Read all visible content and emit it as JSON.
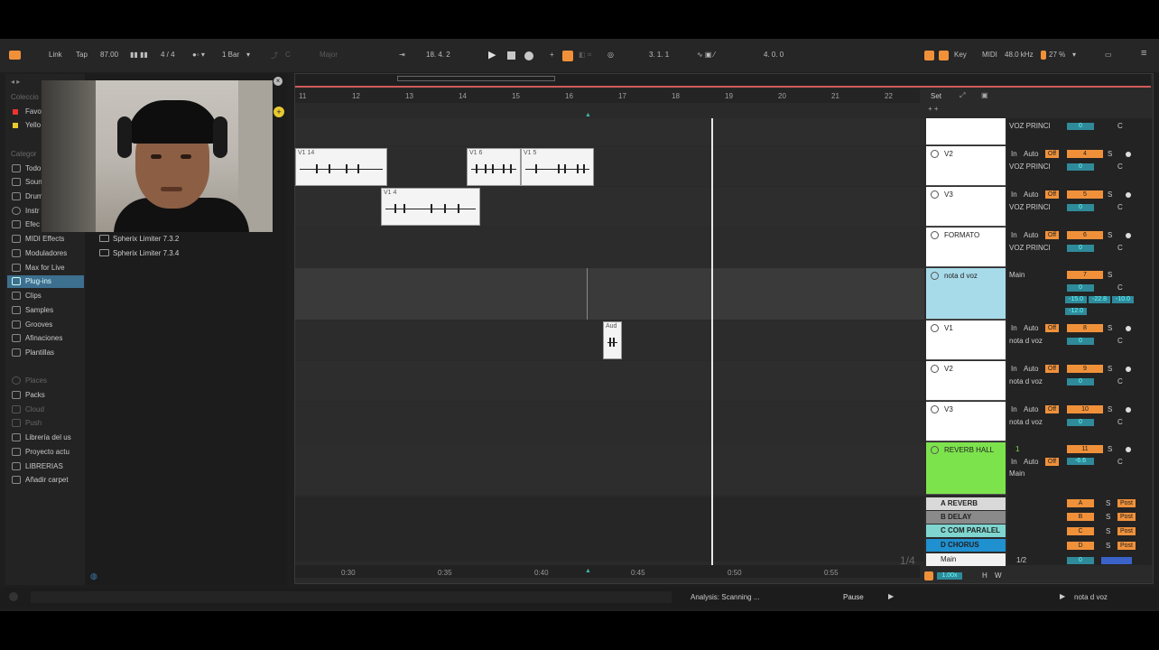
{
  "transport": {
    "link": "Link",
    "tap": "Tap",
    "tempo": "87.00",
    "signature": "4 / 4",
    "quantize": "1 Bar",
    "scale_key": "C",
    "scale_mode": "Major",
    "position": "18.   4.   2",
    "loop_start": "3.   1.   1",
    "loop_length": "4.   0.   0",
    "key_label": "Key",
    "midi_label": "MIDI",
    "sample_rate": "48.0 kHz",
    "cpu": "27 %"
  },
  "browser": {
    "section_collections": "Coleccio",
    "collections": [
      {
        "label": "Favo",
        "color": "#e33"
      },
      {
        "label": "Yello",
        "color": "#e8c930"
      }
    ],
    "section_categories": "Categor",
    "categories": [
      "Todo",
      "Soun",
      "Drum",
      "Instr",
      "Efec",
      "MIDI Effects",
      "Moduladores",
      "Max for Live",
      "Plug-ins",
      "Clips",
      "Samples",
      "Grooves",
      "Afinaciones",
      "Plantillas"
    ],
    "selected_category": "Plug-ins",
    "places": [
      "Places",
      "Packs",
      "Cloud",
      "Push",
      "Librería del us",
      "Proyecto actu",
      "LIBRERIAS",
      "Añadir carpet"
    ],
    "plugins": [
      "Spherix Limiter 7.3.2",
      "Spherix Limiter 7.3.4"
    ]
  },
  "ruler": {
    "bars": [
      "11",
      "12",
      "13",
      "14",
      "15",
      "16",
      "17",
      "18",
      "19",
      "20",
      "21",
      "22"
    ],
    "times": [
      "0:30",
      "0:35",
      "0:40",
      "0:45",
      "0:50",
      "0:55"
    ],
    "page": "1/4",
    "set_label": "Set"
  },
  "clips": [
    {
      "name": "V1 14"
    },
    {
      "name": "V1 6"
    },
    {
      "name": "V1 5"
    },
    {
      "name": "V1 4"
    },
    {
      "name": "Aud"
    }
  ],
  "tracks": [
    {
      "name": "",
      "input": "VOZ PRINCI",
      "num": ""
    },
    {
      "name": "V2",
      "input": "VOZ PRINCI",
      "num": "4"
    },
    {
      "name": "V3",
      "input": "VOZ PRINCI",
      "num": "5"
    },
    {
      "name": "FORMATO",
      "input": "VOZ PRINCI",
      "num": "6"
    },
    {
      "name": "nota d voz",
      "input": "Main",
      "num": "7",
      "group": true,
      "values": [
        "-15.0",
        "-22.8",
        "-10.0",
        "-12.0"
      ]
    },
    {
      "name": "V1",
      "input": "nota d voz",
      "num": "8"
    },
    {
      "name": "V2",
      "input": "nota d voz",
      "num": "9"
    },
    {
      "name": "V3",
      "input": "nota d voz",
      "num": "10"
    },
    {
      "name": "REVERB HALL",
      "input": "Main",
      "num": "11",
      "send": "1",
      "vol": "-6.6"
    }
  ],
  "returns": [
    {
      "name": "A REVERB",
      "letter": "A",
      "color": "#d9d9d9"
    },
    {
      "name": "B DELAY",
      "letter": "B",
      "color": "#8a8a8a"
    },
    {
      "name": "C COM PARALEL",
      "letter": "C",
      "color": "#7fd6d0"
    },
    {
      "name": "D CHORUS",
      "letter": "D",
      "color": "#1f90d0"
    }
  ],
  "main_track": {
    "name": "Main",
    "output": "1/2",
    "vol": "0"
  },
  "mixer_labels": {
    "in": "In",
    "auto": "Auto",
    "off": "Off",
    "solo": "S",
    "center": "C",
    "post": "Post",
    "zero": "0"
  },
  "status": {
    "text": "Analysis: Scanning ...",
    "pause": "Pause",
    "track": "nota d voz",
    "zoom": "1.00x",
    "h": "H",
    "w": "W"
  }
}
